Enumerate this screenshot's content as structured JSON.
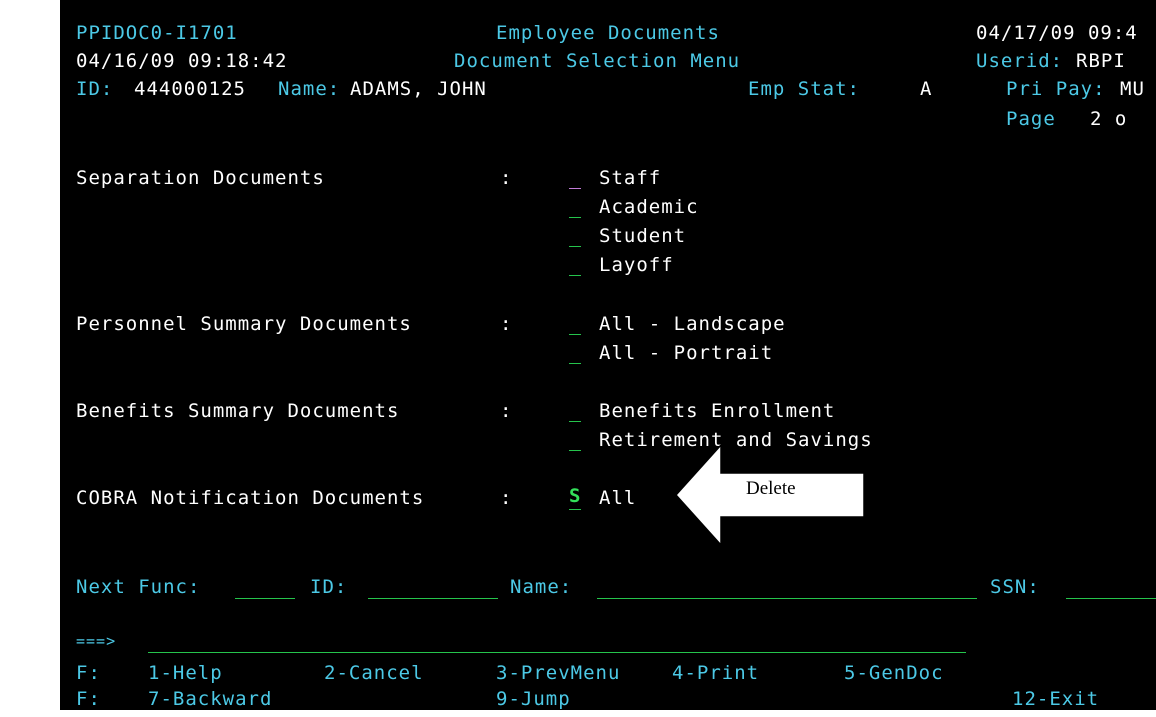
{
  "header": {
    "program_id": "PPIDOC0-I1701",
    "screen_title": "Employee Documents",
    "date_right": "04/17/09 09:4",
    "datetime_left": "04/16/09 09:18:42",
    "menu_title": "Document Selection Menu",
    "userid_label": "Userid:",
    "userid_value": "RBPI",
    "id_label": "ID:",
    "id_value": "444000125",
    "name_label": "Name:",
    "name_value": "ADAMS, JOHN",
    "emp_stat_label": "Emp Stat:",
    "emp_stat_value": "A",
    "pri_pay_label": "Pri Pay:",
    "pri_pay_value": "MU",
    "page_label": "Page",
    "page_value": "2 o"
  },
  "sections": [
    {
      "label": "Separation Documents",
      "colon": ":",
      "options": [
        {
          "sel": "",
          "text": "Staff"
        },
        {
          "sel": "",
          "text": "Academic"
        },
        {
          "sel": "",
          "text": "Student"
        },
        {
          "sel": "",
          "text": "Layoff"
        }
      ]
    },
    {
      "label": "Personnel Summary Documents",
      "colon": ":",
      "options": [
        {
          "sel": "",
          "text": "All - Landscape"
        },
        {
          "sel": "",
          "text": "All - Portrait"
        }
      ]
    },
    {
      "label": "Benefits Summary Documents",
      "colon": ":",
      "options": [
        {
          "sel": "",
          "text": "Benefits Enrollment"
        },
        {
          "sel": "",
          "text": "Retirement and Savings"
        }
      ]
    },
    {
      "label": "COBRA Notification Documents",
      "colon": ":",
      "options": [
        {
          "sel": "S",
          "text": "All"
        }
      ]
    }
  ],
  "footer": {
    "next_func_label": "Next Func:",
    "id_label": "ID:",
    "name_label": "Name:",
    "ssn_label": "SSN:",
    "command_prompt": "===>",
    "fkeys_row1_prefix": "F:",
    "fkeys_row1": [
      "1-Help",
      "2-Cancel",
      "3-PrevMenu",
      "4-Print",
      "5-GenDoc"
    ],
    "fkeys_row2_prefix": "F:",
    "fkeys_row2": [
      "7-Backward",
      "9-Jump",
      "12-Exit"
    ]
  },
  "callout": {
    "label": "Delete"
  }
}
